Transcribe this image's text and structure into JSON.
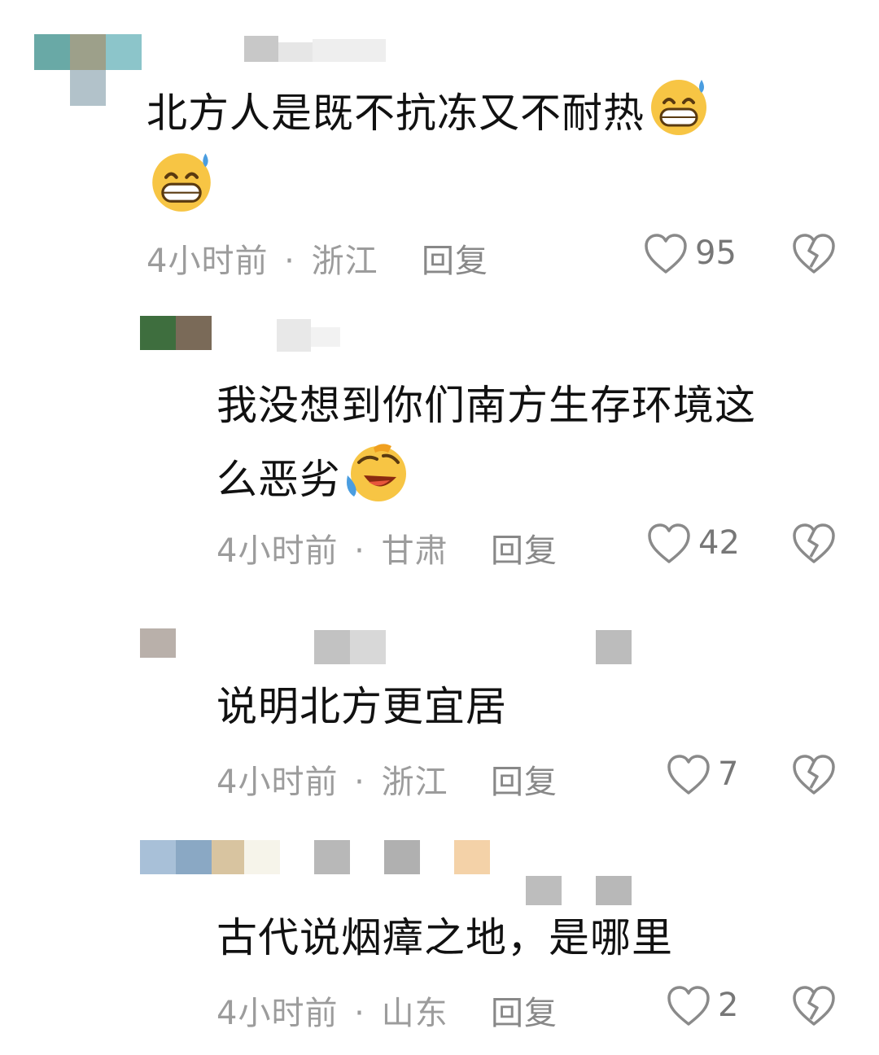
{
  "comments": [
    {
      "text": "北方人是既不抗冻又不耐热",
      "time": "4小时前",
      "location": "浙江",
      "reply_label": "回复",
      "likes": "95"
    },
    {
      "text_line1": "我没想到你们南方生存环境这",
      "text_line2": "么恶劣",
      "time": "4小时前",
      "location": "甘肃",
      "reply_label": "回复",
      "likes": "42"
    },
    {
      "text": "说明北方更宜居",
      "time": "4小时前",
      "location": "浙江",
      "reply_label": "回复",
      "likes": "7"
    },
    {
      "text": "古代说烟瘴之地，是哪里",
      "time": "4小时前",
      "location": "山东",
      "reply_label": "回复",
      "likes": "2"
    }
  ],
  "separator": "·",
  "icons": {
    "like": "heart-outline-icon",
    "dislike": "broken-heart-icon",
    "emoji_sweat": "grinning-sweat-emoji",
    "emoji_laugh": "rolling-laughing-emoji"
  },
  "colors": {
    "text": "#111111",
    "meta": "#9c9c9c",
    "icon": "#8a8a8a"
  }
}
